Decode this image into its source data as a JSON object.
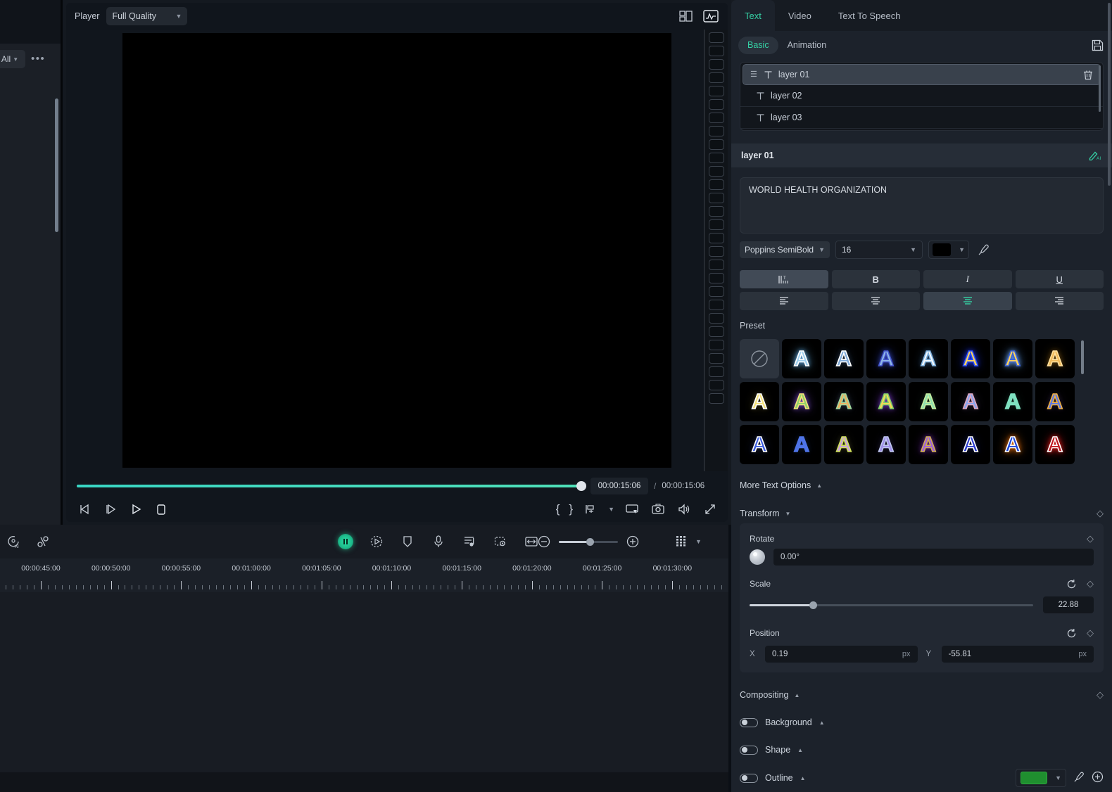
{
  "left_sidebar": {
    "filter_label": "All",
    "more_label": "•••"
  },
  "player": {
    "label": "Player",
    "quality": "Full Quality",
    "quality_chevron": "chevron-down-icon",
    "layout_icon": "split-view-icon",
    "scope_icon": "waveform-monitor-icon",
    "current_time": "00:00:15:06",
    "separator": "/",
    "total_time": "00:00:15:06",
    "controls": {
      "prev_frame": "previous-frame-icon",
      "next_frame": "next-frame-icon",
      "play": "play-icon",
      "stop": "stop-icon",
      "mark_in": "{",
      "mark_out": "}",
      "markers": "marker-icon",
      "markers_chevron": "chevron-down-icon",
      "snapshot_screen": "display-icon",
      "camera": "camera-icon",
      "volume": "volume-icon",
      "fullscreen": "fullscreen-icon"
    }
  },
  "timeline": {
    "tools_left": [
      "auto-reframe-ai-icon",
      "unlink-icon"
    ],
    "tools_center": [
      "record-voiceover-active-icon",
      "auto-beat-sync-icon",
      "marker-add-icon",
      "microphone-icon",
      "audio-mixer-icon",
      "green-screen-icon",
      "fit-to-timeline-icon"
    ],
    "zoom_out_icon": "zoom-out-icon",
    "zoom_in_icon": "zoom-in-icon",
    "grid_icon": "grid-view-icon",
    "grid_chevron": "chevron-down-icon",
    "ruler_labels": [
      "00:00:45:00",
      "00:00:50:00",
      "00:00:55:00",
      "00:01:00:00",
      "00:01:05:00",
      "00:01:10:00",
      "00:01:15:00",
      "00:01:20:00",
      "00:01:25:00",
      "00:01:30:00"
    ]
  },
  "right_panel": {
    "tabs": [
      {
        "label": "Text",
        "active": true
      },
      {
        "label": "Video",
        "active": false
      },
      {
        "label": "Text To Speech",
        "active": false
      }
    ],
    "subtabs": [
      {
        "label": "Basic",
        "active": true
      },
      {
        "label": "Animation",
        "active": false
      }
    ],
    "save_icon": "save-preset-icon",
    "layers": [
      {
        "label": "layer 01",
        "selected": true
      },
      {
        "label": "layer 02",
        "selected": false
      },
      {
        "label": "layer 03",
        "selected": false
      }
    ],
    "delete_icon": "trash-icon",
    "selected_layer_title": "layer 01",
    "ai_icon": "ai-write-icon",
    "text_content": "WORLD HEALTH ORGANIZATION",
    "font": {
      "family": "Poppins SemiBold",
      "size": "16",
      "color_hex": "#000000",
      "eyedropper_icon": "eyedropper-icon"
    },
    "style_buttons": [
      {
        "name": "text-spacing",
        "glyph": "spacing-icon",
        "active": true
      },
      {
        "name": "bold",
        "glyph": "B",
        "active": false
      },
      {
        "name": "italic",
        "glyph": "I",
        "active": false
      },
      {
        "name": "underline",
        "glyph": "U",
        "active": false
      }
    ],
    "align_buttons": [
      {
        "name": "align-left",
        "active": false
      },
      {
        "name": "align-center",
        "active": false
      },
      {
        "name": "align-middle",
        "active": true
      },
      {
        "name": "align-right",
        "active": false
      }
    ],
    "preset_label": "Preset",
    "presets": [
      [
        {
          "type": "none",
          "icon": "no-preset-icon"
        },
        {
          "fill": "#9fd0f0",
          "stroke": "#ffffff",
          "glow": "#6fc0ff"
        },
        {
          "fill": "#7ea9d8",
          "stroke": "#ffffff",
          "glow": "#223044"
        },
        {
          "fill": "#8fb6e8",
          "stroke": "#4455cc",
          "glow": "#3344bb"
        },
        {
          "fill": "#f2f8ff",
          "stroke": "#7fb2e0",
          "glow": "#2a4668"
        },
        {
          "fill": "#ffd45e",
          "stroke": "#2a4fff",
          "glow": "#2038ff"
        },
        {
          "fill": "#ffd45e",
          "stroke": "#3b63d8",
          "glow": "#6aa8ff"
        },
        {
          "fill": "#f2bb5a",
          "stroke": "#ffe1a0",
          "glow": "#6b4a12"
        }
      ],
      [
        {
          "fill": "#f5e27a",
          "stroke": "#ffffff",
          "glow": "#3a3418"
        },
        {
          "fill": "#8fd06a",
          "stroke": "#f5e27a",
          "glow": "#7b4bd0"
        },
        {
          "fill": "#f0b060",
          "stroke": "#9fd8a0",
          "glow": "#2a3340"
        },
        {
          "fill": "#f5d95a",
          "stroke": "#7fd06a",
          "glow": "#7b3bd0"
        },
        {
          "fill": "#8fe0b0",
          "stroke": "#c8f0a0",
          "glow": "#1a2a22"
        },
        {
          "fill": "#8aa6ef",
          "stroke": "#e0a8c0",
          "glow": "#2a2438"
        },
        {
          "fill": "#7fe0c0",
          "stroke": "#7fe0c0",
          "glow": "#12241f"
        },
        {
          "fill": "#5b78e8",
          "stroke": "#f0b040",
          "glow": "#241a2e"
        }
      ],
      [
        {
          "fill": "#3b5ce0",
          "stroke": "#ffffff",
          "glow": "#1a2242"
        },
        {
          "fill": "#4f74e8",
          "stroke": "#4f74e8",
          "glow": "#101a2e"
        },
        {
          "fill": "#c8a0e0",
          "stroke": "#cfe05a",
          "glow": "#2a2a18"
        },
        {
          "fill": "#9f8fe8",
          "stroke": "#c0c8f0",
          "glow": "#1e1a32"
        },
        {
          "fill": "#a060e0",
          "stroke": "#d0b050",
          "glow": "#6a2a9a"
        },
        {
          "fill": "#2a3bd0",
          "stroke": "#ffffff",
          "glow": "#101840"
        },
        {
          "fill": "#1a44d8",
          "stroke": "#ffffff",
          "glow": "#ff7a10"
        },
        {
          "fill": "#c01820",
          "stroke": "#ffffff",
          "glow": "#ff2020"
        }
      ]
    ],
    "more_text_options": {
      "label": "More Text Options",
      "caret": "caret-up-icon"
    },
    "transform": {
      "label": "Transform",
      "caret": "caret-down-icon",
      "keyframe_icon": "keyframe-diamond-icon",
      "rotate": {
        "label": "Rotate",
        "value": "0.00°"
      },
      "scale": {
        "label": "Scale",
        "value": "22.88",
        "reset_icon": "reset-icon"
      },
      "position": {
        "label": "Position",
        "x_label": "X",
        "x_value": "0.19",
        "x_unit": "px",
        "y_label": "Y",
        "y_value": "-55.81",
        "y_unit": "px",
        "reset_icon": "reset-icon"
      }
    },
    "compositing": {
      "label": "Compositing",
      "caret": "caret-up-icon",
      "rows": [
        {
          "label": "Background",
          "enabled": false
        },
        {
          "label": "Shape",
          "enabled": false
        },
        {
          "label": "Outline",
          "enabled": false,
          "color_hex": "#1f8f2f",
          "eyedropper_icon": "eyedropper-icon",
          "add_icon": "add-circle-icon"
        }
      ]
    }
  }
}
